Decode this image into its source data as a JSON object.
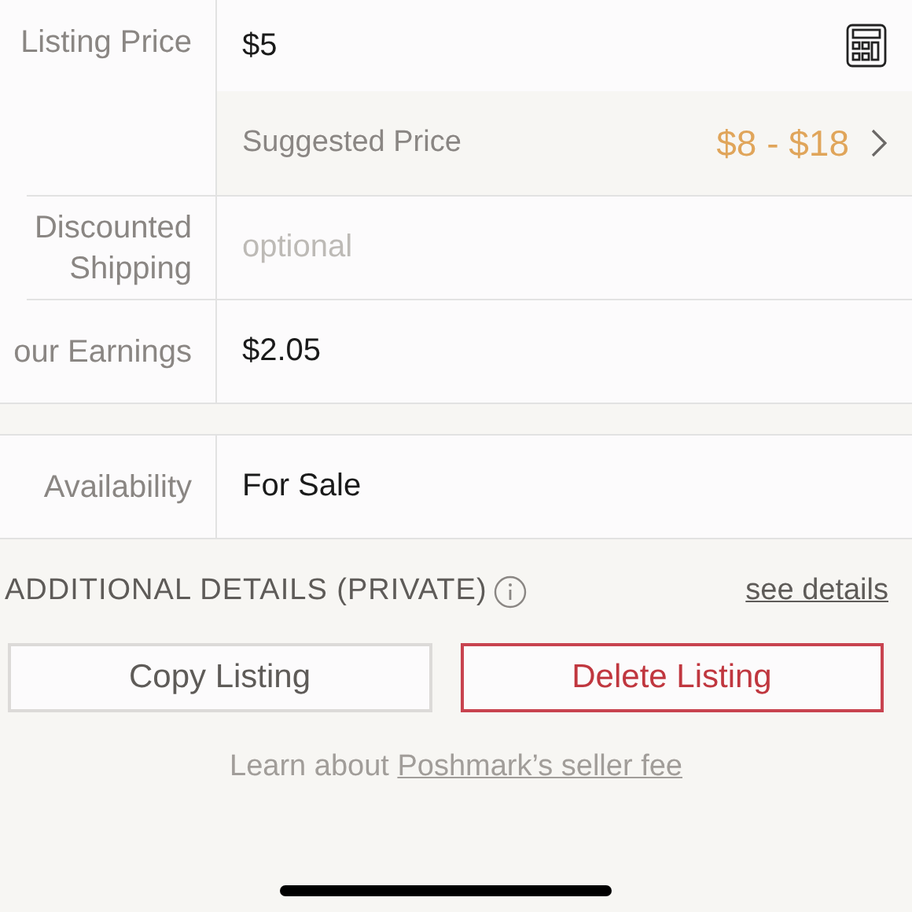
{
  "price_rows": [
    {
      "label": "Listing Price",
      "value": "$5",
      "suggested": {
        "label": "Suggested Price",
        "range": "$8 - $18"
      }
    },
    {
      "label": "Discounted\nShipping",
      "placeholder": "optional"
    },
    {
      "label": "our Earnings",
      "value": "$2.05"
    }
  ],
  "availability": {
    "label": "Availability",
    "value": "For Sale"
  },
  "additional_details": {
    "title": "ADDITIONAL DETAILS (PRIVATE)",
    "link": "see details"
  },
  "buttons": [
    {
      "label": "Copy Listing",
      "kind": "neutral"
    },
    {
      "label": "Delete Listing",
      "kind": "danger"
    }
  ],
  "footer": {
    "text": "Learn about",
    "link": "Poshmark’s seller fee"
  }
}
